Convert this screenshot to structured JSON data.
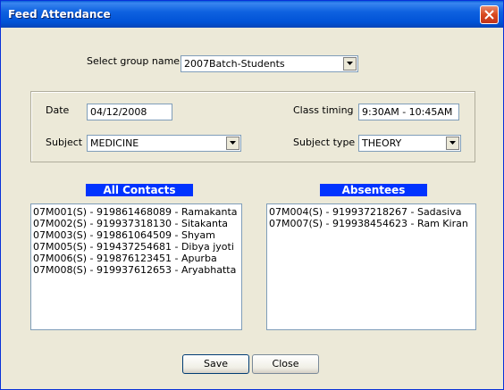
{
  "window": {
    "title": "Feed Attendance"
  },
  "group": {
    "label": "Select group name",
    "value": "2007Batch-Students"
  },
  "date": {
    "label": "Date",
    "value": "04/12/2008"
  },
  "class_timing": {
    "label": "Class timing",
    "value": "9:30AM - 10:45AM"
  },
  "subject": {
    "label": "Subject",
    "value": "MEDICINE"
  },
  "subject_type": {
    "label": "Subject type",
    "value": "THEORY"
  },
  "all_contacts": {
    "header": "All Contacts",
    "items": [
      "07M001(S) - 919861468089 - Ramakanta",
      "07M002(S) - 919937318130 - Sitakanta",
      "07M003(S) - 919861064509 - Shyam",
      "07M005(S) - 919437254681 - Dibya jyoti",
      "07M006(S) - 919876123451 - Apurba",
      "07M008(S) - 919937612653 - Aryabhatta"
    ]
  },
  "absentees": {
    "header": "Absentees",
    "items": [
      "07M004(S) - 919937218267 - Sadasiva",
      "07M007(S) - 919938454623 - Ram Kiran"
    ]
  },
  "buttons": {
    "save": "Save",
    "close": "Close"
  }
}
